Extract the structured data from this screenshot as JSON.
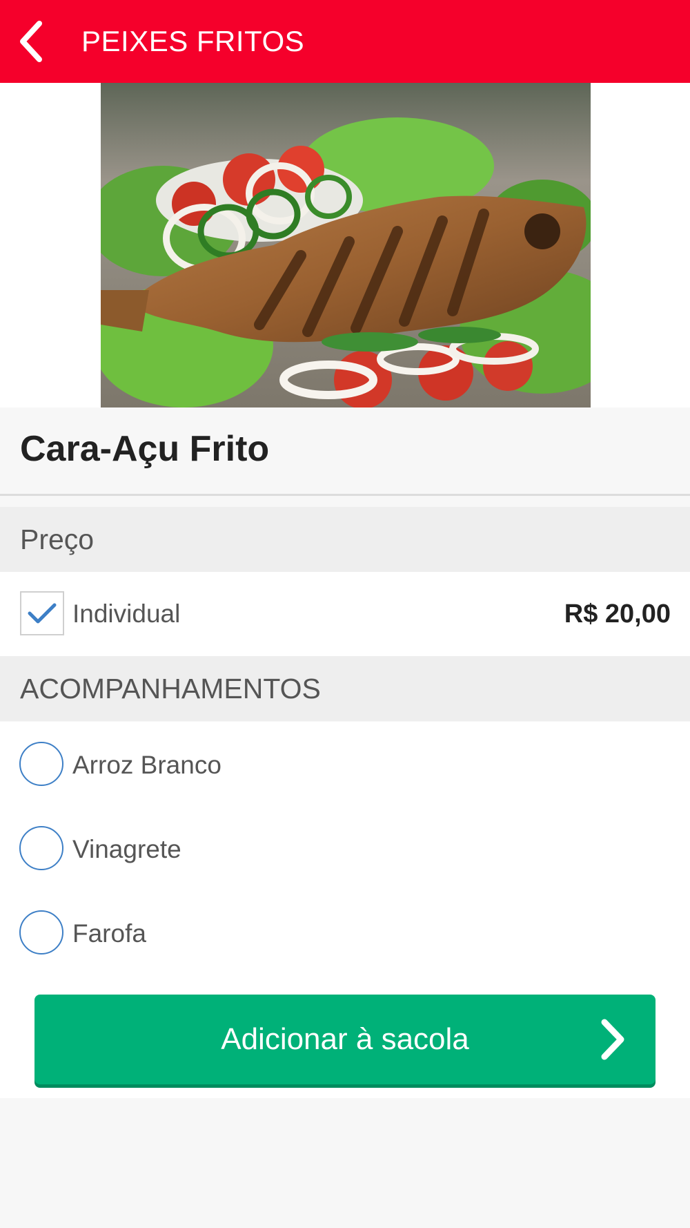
{
  "header": {
    "title": "PEIXES FRITOS",
    "back_icon": "chevron-left-icon",
    "color": "#f5002b"
  },
  "product": {
    "image": "fried-fish-photo",
    "name": "Cara-Açu Frito"
  },
  "price_section": {
    "heading": "Preço",
    "options": [
      {
        "label": "Individual",
        "price": "R$ 20,00",
        "checked": true
      }
    ]
  },
  "sides_section": {
    "heading": "ACOMPANHAMENTOS",
    "options": [
      {
        "label": "Arroz Branco",
        "selected": false
      },
      {
        "label": "Vinagrete",
        "selected": false
      },
      {
        "label": "Farofa",
        "selected": false
      }
    ]
  },
  "cta": {
    "label": "Adicionar à sacola",
    "icon": "chevron-right-icon",
    "color": "#00b178"
  }
}
